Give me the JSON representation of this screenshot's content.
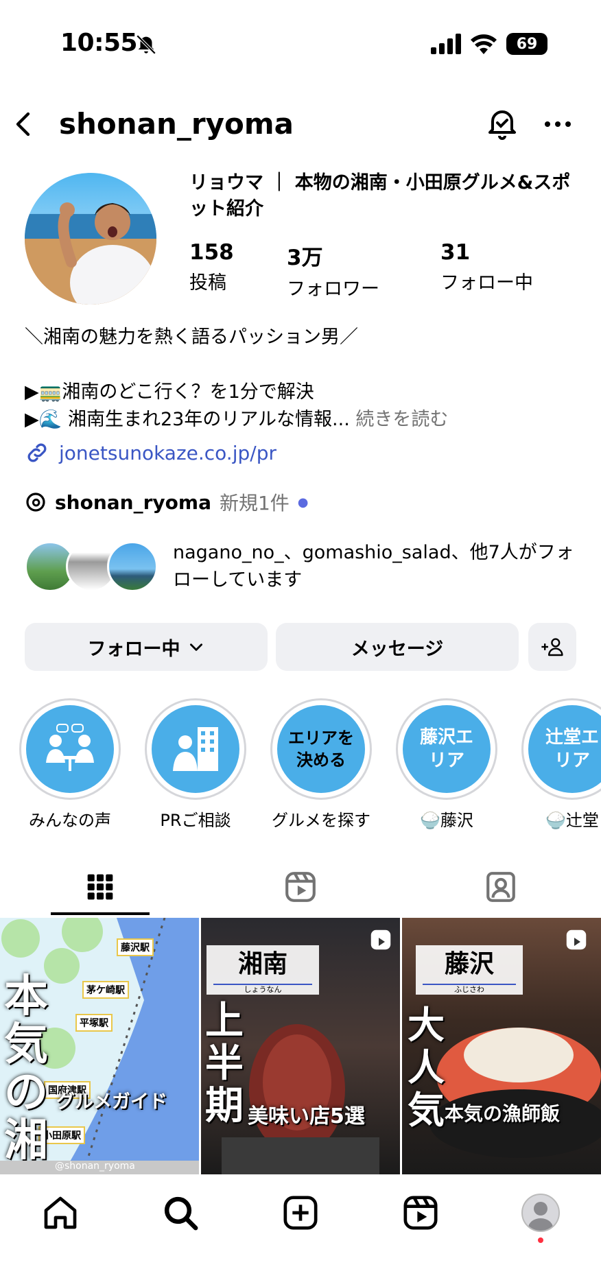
{
  "status_bar": {
    "time": "10:55",
    "battery": "69"
  },
  "header": {
    "username": "shonan_ryoma"
  },
  "profile": {
    "display_name": "リョウマ ｜ 本物の湘南・小田原グルメ&スポット紹介",
    "stats": [
      {
        "value": "158",
        "label": "投稿"
      },
      {
        "value": "3万",
        "label": "フォロワー"
      },
      {
        "value": "31",
        "label": "フォロー中"
      }
    ],
    "bio_line1": "＼湘南の魅力を熱く語るパッション男／",
    "bio_line2": "▶🚃湘南のどこ行く？を1分で解決",
    "bio_line3": "▶🌊 湘南生まれ23年のリアルな情報...",
    "read_more": "続きを読む",
    "link": "jonetsunokaze.co.jp/pr",
    "threads_name": "shonan_ryoma",
    "threads_new": "新規1件",
    "followed_by": "nagano_no_、gomashio_salad、他7人がフォローしています"
  },
  "buttons": {
    "following": "フォロー中",
    "message": "メッセージ"
  },
  "highlights": [
    {
      "label": "みんなの声",
      "inner": ""
    },
    {
      "label": "PRご相談",
      "inner": ""
    },
    {
      "label": "グルメを探す",
      "inner": "エリアを決める"
    },
    {
      "label": "🍚藤沢",
      "inner": "藤沢エリア"
    },
    {
      "label": "🍚辻堂",
      "inner": "辻堂エリア"
    }
  ],
  "posts": [
    {
      "big": "本気の湘南",
      "sub": "グルメガイド",
      "watermark": "@shonan_ryoma",
      "stations": [
        "藤沢駅",
        "茅ケ崎駅",
        "平塚駅",
        "国府津駅",
        "小田原駅"
      ]
    },
    {
      "title": "湘南",
      "furigana": "しょうなん",
      "big": "上半期",
      "sub": "美味い店5選"
    },
    {
      "title": "藤沢",
      "furigana": "ふじさわ",
      "big": "大人気",
      "sub": "本気の漁師飯"
    }
  ],
  "colors": {
    "link": "#3a56c4",
    "highlight": "#4aaee8",
    "button_bg": "#eff0f3"
  }
}
